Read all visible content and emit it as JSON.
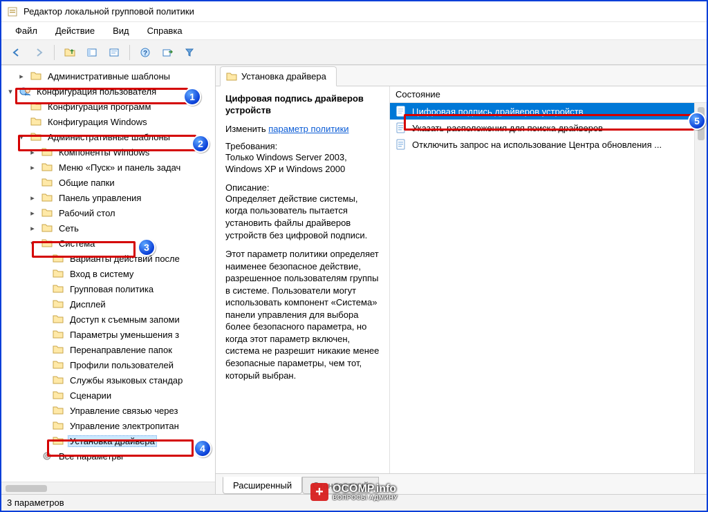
{
  "window": {
    "title": "Редактор локальной групповой политики"
  },
  "menubar": {
    "file": "Файл",
    "action": "Действие",
    "view": "Вид",
    "help": "Справка"
  },
  "toolbar_icons": {
    "back": "←",
    "forward": "→",
    "up": "⬆",
    "pane": "▥",
    "props": "▤",
    "refresh": "⟳",
    "help": "?",
    "export": "▦",
    "filter": "⏷"
  },
  "tree": {
    "top_folder": "Административные шаблоны",
    "user_config": "Конфигурация пользователя",
    "software_config": "Конфигурация программ",
    "windows_config": "Конфигурация Windows",
    "admin_templates": "Административные шаблоны",
    "components_windows": "Компоненты Windows",
    "start_taskbar": "Меню «Пуск» и панель задач",
    "shared_folders": "Общие папки",
    "control_panel": "Панель управления",
    "desktop": "Рабочий стол",
    "network": "Сеть",
    "system": "Система",
    "action_variants": "Варианты действий после",
    "logon": "Вход в систему",
    "group_policy": "Групповая политика",
    "display": "Дисплей",
    "removable_access": "Доступ к съемным запоми",
    "reduce_delay": "Параметры уменьшения з",
    "folder_redirection": "Перенаправление папок",
    "user_profiles": "Профили пользователей",
    "lang_services": "Службы языковых стандар",
    "scripts": "Сценарии",
    "comm_mgmt": "Управление связью через",
    "power_mgmt": "Управление электропитан",
    "driver_install": "Установка драйвера",
    "all_settings": "Все параметры"
  },
  "right": {
    "tab_label": "Установка драйвера",
    "detail_title": "Цифровая подпись драйверов устройств",
    "change_label": "Изменить",
    "policy_link": "параметр политики",
    "requirements_label": "Требования:",
    "requirements_text": "Только Windows Server 2003, Windows XP и Windows 2000",
    "description_label": "Описание:",
    "description_text1": "Определяет действие системы, когда пользователь пытается установить файлы драйверов устройств без цифровой подписи.",
    "description_text2": "Этот параметр политики определяет наименее безопасное действие, разрешенное пользователям группы в системе. Пользователи могут использовать компонент «Система» панели управления для выбора более безопасного параметра, но когда этот параметр включен, система не разрешит никакие менее безопасные параметры, чем тот, который выбран.",
    "list_header": "Состояние",
    "items": [
      "Цифровая подпись драйверов устройств",
      "Указать расположения для поиска драйверов",
      "Отключить запрос на использование Центра обновления ..."
    ],
    "tabs": {
      "extended": "Расширенный",
      "standard": "Стандартный"
    }
  },
  "statusbar": {
    "text": "3 параметров"
  },
  "annotations": {
    "a1": "1",
    "a2": "2",
    "a3": "3",
    "a4": "4",
    "a5": "5"
  },
  "watermark": {
    "line1": "OCOMP.info",
    "line2": "ВОПРОСЫ АДМИНУ"
  }
}
